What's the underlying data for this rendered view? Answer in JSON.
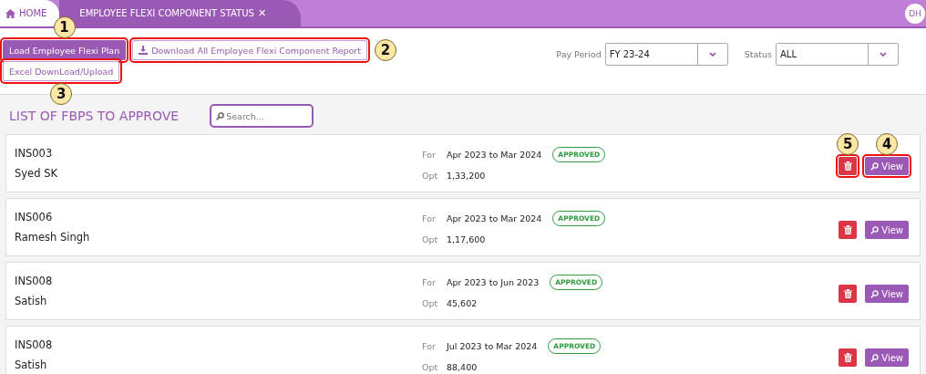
{
  "tabs": [
    {
      "label": "HOME",
      "selected": false,
      "kind": "home"
    },
    {
      "label": "EMPLOYEE FLEXI COMPONENT STATUS",
      "selected": true,
      "kind": "closable",
      "close": "✕"
    }
  ],
  "user": {
    "initials": "DH"
  },
  "toolbar": {
    "buttons": [
      {
        "label": "Load Employee Flexi Plan",
        "kind": "primary",
        "callout": "1"
      },
      {
        "label": "Download All Employee Flexi Component Report",
        "kind": "download",
        "callout": "2"
      },
      {
        "label": "Excel DownLoad/Upload",
        "kind": "outline",
        "callout": "3"
      }
    ]
  },
  "filters": [
    {
      "label": "Pay Period",
      "value": "FY 23-24"
    },
    {
      "label": "Status",
      "value": "ALL"
    }
  ],
  "list": {
    "title": "LIST OF FBPS TO APPROVE",
    "search_placeholder": "Search..."
  },
  "rows": [
    {
      "code": "INS003",
      "name": "Syed SK",
      "for_label": "For",
      "period": "Apr 2023 to Mar 2024",
      "status": "APPROVED",
      "opt_label": "Opt",
      "amount": "1,33,200",
      "view_label": "View",
      "delete_callout": "5",
      "view_callout": "4"
    },
    {
      "code": "INS006",
      "name": "Ramesh Singh",
      "for_label": "For",
      "period": "Apr 2023 to Mar 2024",
      "status": "APPROVED",
      "opt_label": "Opt",
      "amount": "1,17,600",
      "view_label": "View"
    },
    {
      "code": "INS008",
      "name": "Satish",
      "for_label": "For",
      "period": "Apr 2023 to Jun 2023",
      "status": "APPROVED",
      "opt_label": "Opt",
      "amount": "45,602",
      "view_label": "View"
    },
    {
      "code": "INS008",
      "name": "Satish",
      "for_label": "For",
      "period": "Jul 2023 to Mar 2024",
      "status": "APPROVED",
      "opt_label": "Opt",
      "amount": "88,400",
      "view_label": "View"
    }
  ]
}
